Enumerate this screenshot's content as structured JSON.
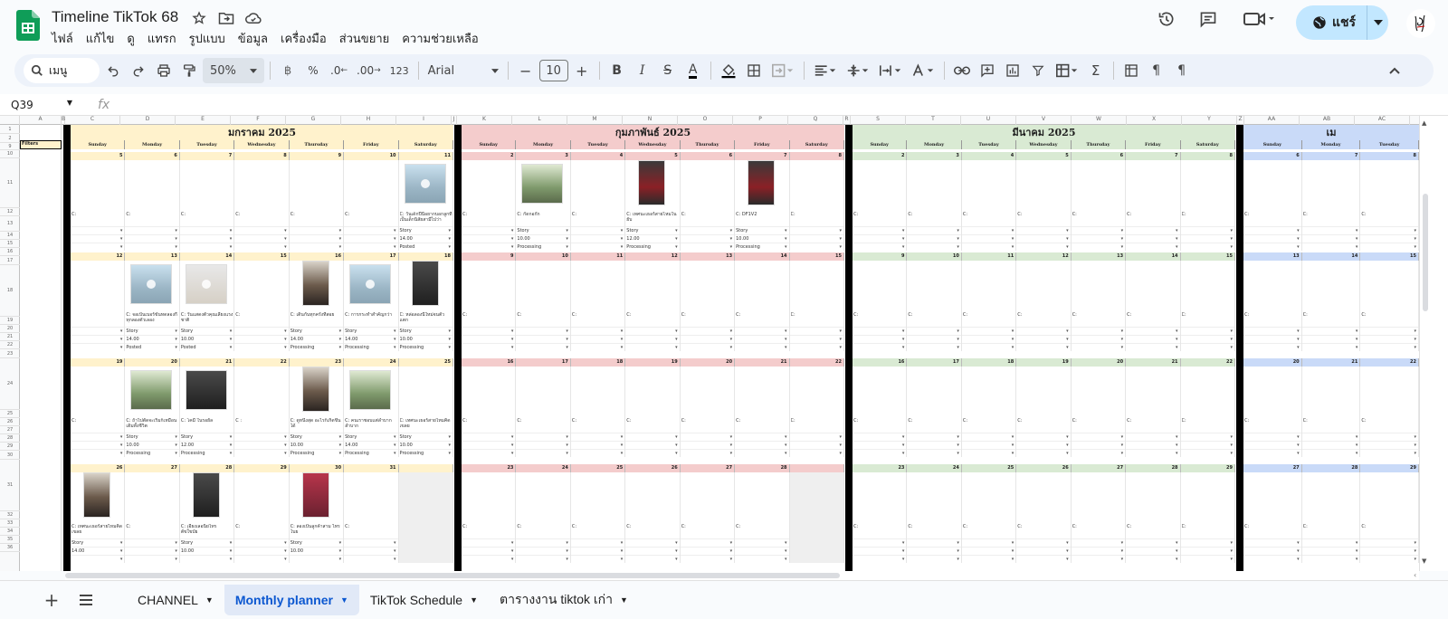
{
  "app": {
    "title": "Timeline TikTok 68",
    "menus": [
      "ไฟล์",
      "แก้ไข",
      "ดู",
      "แทรก",
      "รูปแบบ",
      "ข้อมูล",
      "เครื่องมือ",
      "ส่วนขยาย",
      "ความช่วยเหลือ"
    ],
    "share_label": "แชร์",
    "accent": "#c2e7ff"
  },
  "toolbar": {
    "search_label": "เมนู",
    "zoom": "50%",
    "percent": "%",
    "dec_less": ".0",
    "dec_more": ".00",
    "num_format": "123",
    "font": "Arial",
    "font_size": "10",
    "bold": "B",
    "italic": "I",
    "text_color": "A"
  },
  "formula_bar": {
    "cell_ref": "Q39",
    "fx": "fx"
  },
  "grid": {
    "columns": [
      "A",
      "B",
      "C",
      "D",
      "E",
      "F",
      "G",
      "H",
      "I",
      "J",
      "K",
      "L",
      "M",
      "N",
      "O",
      "P",
      "Q",
      "R",
      "S",
      "T",
      "U",
      "V",
      "W",
      "X",
      "Y",
      "Z",
      "AA",
      "AB",
      "AC"
    ],
    "rows": [
      "1",
      "2",
      "9",
      "10",
      "11",
      "12",
      "13",
      "14",
      "15",
      "16",
      "17",
      "18",
      "19",
      "20",
      "21",
      "22",
      "23",
      "24",
      "25",
      "26",
      "27",
      "28",
      "29",
      "30",
      "31",
      "32",
      "33",
      "34",
      "35",
      "36"
    ],
    "filters_label": "Filters",
    "day_names": [
      "Sunday",
      "Monday",
      "Tuesday",
      "Wednesday",
      "Thursday",
      "Friday",
      "Saturday"
    ],
    "months": [
      {
        "title": "มกราคม 2025",
        "color": "#fff2cc",
        "weeks": [
          {
            "days": [
              "5",
              "6",
              "7",
              "8",
              "9",
              "10",
              "11"
            ],
            "thumbs": [
              "",
              "",
              "",
              "",
              "",
              "",
              "s"
            ],
            "captions": [
              "C:",
              "C:",
              "C:",
              "C:",
              "C:",
              "C:",
              "C: วันเด็กปีนี้อยากบอกลูกที่เป็นเด็กนิสัยสามีไปว่า"
            ],
            "type": [
              "",
              "",
              "",
              "",
              "",
              "",
              "Story"
            ],
            "time": [
              "",
              "",
              "",
              "",
              "",
              "",
              "14.00"
            ],
            "status": [
              "",
              "",
              "",
              "",
              "",
              "",
              "Posted"
            ]
          },
          {
            "days": [
              "12",
              "13",
              "14",
              "15",
              "16",
              "17",
              "18"
            ],
            "thumbs": [
              "",
              "s",
              "d",
              "",
              "p",
              "s",
              "k"
            ],
            "captions": [
              "",
              "C: จอเป็นเบอร์ขันทดลองกี่ทุกลองตัวเลอง",
              "C: วันแสดงตัวคุณเลี้ยงแรงชาติ",
              "C:",
              "C: เดินกันทุกครั้งที่สอย",
              "C: การกระทำสำคัญกว่า",
              "C: หล่อลองนีใหม่จนตัวแตก"
            ],
            "type": [
              "",
              "Story",
              "Story",
              "",
              "Story",
              "Story",
              "Story"
            ],
            "time": [
              "",
              "14.00",
              "10.00",
              "",
              "14.00",
              "14.00",
              "10.00"
            ],
            "status": [
              "",
              "Posted",
              "Posted",
              "",
              "Processing",
              "Processing",
              "Processing"
            ]
          },
          {
            "days": [
              "19",
              "20",
              "21",
              "22",
              "23",
              "24",
              "25"
            ],
            "thumbs": [
              "",
              "g",
              "k",
              "",
              "p",
              "g",
              ""
            ],
            "captions": [
              "C:",
              "C: ถ้าไปตัดจะเริ่มก็เหมือนเดิมทั้งชีวิต",
              "C: โคมี่ ในรอยัล",
              "C :",
              "C: ดูหนึ่งสุด อะไรก็เกิดขึ้นได้",
              "C: คนเราชอบแต่ลำบากลำบาก",
              "C: เทศนะเธอร์สายไหมคิดเขลย"
            ],
            "type": [
              "",
              "Story",
              "Story",
              "",
              "Story",
              "Story",
              "Story"
            ],
            "time": [
              "",
              "10.00",
              "12.00",
              "",
              "10.00",
              "14.00",
              "10.00"
            ],
            "status": [
              "",
              "Processing",
              "Processing",
              "",
              "Processing",
              "Processing",
              "Processing"
            ]
          },
          {
            "days": [
              "26",
              "27",
              "28",
              "29",
              "30",
              "31",
              ""
            ],
            "thumbs": [
              "p",
              "",
              "k",
              "",
              "m",
              "",
              ""
            ],
            "captions": [
              "C: เทศนะเธอร์สายไหมคิดเขลย",
              "C:",
              "C: เอียงเลอนิยไทรต์ขใขบัย",
              "C:",
              "C: ลองเป็นลูกค้าสาม ไทรไบย",
              "C:",
              ""
            ],
            "type": [
              "Story",
              "",
              "Story",
              "",
              "Story",
              "",
              ""
            ],
            "time": [
              "14.00",
              "",
              "10.00",
              "",
              "10.00",
              "",
              ""
            ],
            "status": [
              "",
              "",
              "",
              "",
              "",
              "",
              ""
            ]
          }
        ]
      },
      {
        "title": "กุมภาพันธ์ 2025",
        "color": "#f4cccc",
        "weeks": [
          {
            "days": [
              "2",
              "3",
              "4",
              "5",
              "6",
              "7",
              "8"
            ],
            "thumbs": [
              "",
              "g",
              "",
              "r",
              "",
              "r",
              ""
            ],
            "captions": [
              "C:",
              "C: กัดกอกัก",
              "C:",
              "C: เทศนะเธอร์สายไหมในยับ",
              "C:",
              "C: DF1V2",
              "C:"
            ],
            "type": [
              "",
              "Story",
              "",
              "Story",
              "",
              "Story",
              ""
            ],
            "time": [
              "",
              "10.00",
              "",
              "12.00",
              "",
              "10.00",
              ""
            ],
            "status": [
              "",
              "Processing",
              "",
              "Processing",
              "",
              "Processing",
              ""
            ]
          },
          {
            "days": [
              "9",
              "10",
              "11",
              "12",
              "13",
              "14",
              "15"
            ],
            "thumbs": [
              "",
              "",
              "",
              "",
              "",
              "",
              ""
            ],
            "captions": [
              "C:",
              "C:",
              "C:",
              "C:",
              "C:",
              "C:",
              "C:"
            ],
            "type": [
              "",
              "",
              "",
              "",
              "",
              "",
              ""
            ],
            "time": [
              "",
              "",
              "",
              "",
              "",
              "",
              ""
            ],
            "status": [
              "",
              "",
              "",
              "",
              "",
              "",
              ""
            ]
          },
          {
            "days": [
              "16",
              "17",
              "18",
              "19",
              "20",
              "21",
              "22"
            ],
            "thumbs": [
              "",
              "",
              "",
              "",
              "",
              "",
              ""
            ],
            "captions": [
              "C:",
              "C:",
              "C:",
              "C:",
              "C:",
              "C:",
              "C:"
            ],
            "type": [
              "",
              "",
              "",
              "",
              "",
              "",
              ""
            ],
            "time": [
              "",
              "",
              "",
              "",
              "",
              "",
              ""
            ],
            "status": [
              "",
              "",
              "",
              "",
              "",
              "",
              ""
            ]
          },
          {
            "days": [
              "23",
              "24",
              "25",
              "26",
              "27",
              "28",
              ""
            ],
            "thumbs": [
              "",
              "",
              "",
              "",
              "",
              "",
              ""
            ],
            "captions": [
              "C:",
              "C:",
              "C:",
              "C:",
              "C:",
              "C:",
              ""
            ],
            "type": [
              "",
              "",
              "",
              "",
              "",
              "",
              ""
            ],
            "time": [
              "",
              "",
              "",
              "",
              "",
              "",
              ""
            ],
            "status": [
              "",
              "",
              "",
              "",
              "",
              "",
              ""
            ]
          }
        ]
      },
      {
        "title": "มีนาคม 2025",
        "color": "#d9ead3",
        "weeks": [
          {
            "days": [
              "2",
              "3",
              "4",
              "5",
              "6",
              "7",
              "8"
            ],
            "thumbs": [
              "",
              "",
              "",
              "",
              "",
              "",
              ""
            ],
            "captions": [
              "C:",
              "C:",
              "C:",
              "C:",
              "C:",
              "C:",
              "C:"
            ],
            "type": [
              "",
              "",
              "",
              "",
              "",
              "",
              ""
            ],
            "time": [
              "",
              "",
              "",
              "",
              "",
              "",
              ""
            ],
            "status": [
              "",
              "",
              "",
              "",
              "",
              "",
              ""
            ]
          },
          {
            "days": [
              "9",
              "10",
              "11",
              "12",
              "13",
              "14",
              "15"
            ],
            "thumbs": [
              "",
              "",
              "",
              "",
              "",
              "",
              ""
            ],
            "captions": [
              "C:",
              "C:",
              "C:",
              "C:",
              "C:",
              "C:",
              "C:"
            ],
            "type": [
              "",
              "",
              "",
              "",
              "",
              "",
              ""
            ],
            "time": [
              "",
              "",
              "",
              "",
              "",
              "",
              ""
            ],
            "status": [
              "",
              "",
              "",
              "",
              "",
              "",
              ""
            ]
          },
          {
            "days": [
              "16",
              "17",
              "18",
              "19",
              "20",
              "21",
              "22"
            ],
            "thumbs": [
              "",
              "",
              "",
              "",
              "",
              "",
              ""
            ],
            "captions": [
              "C:",
              "C:",
              "C:",
              "C:",
              "C:",
              "C:",
              "C:"
            ],
            "type": [
              "",
              "",
              "",
              "",
              "",
              "",
              ""
            ],
            "time": [
              "",
              "",
              "",
              "",
              "",
              "",
              ""
            ],
            "status": [
              "",
              "",
              "",
              "",
              "",
              "",
              ""
            ]
          },
          {
            "days": [
              "23",
              "24",
              "25",
              "26",
              "27",
              "28",
              "29"
            ],
            "thumbs": [
              "",
              "",
              "",
              "",
              "",
              "",
              ""
            ],
            "captions": [
              "C:",
              "C:",
              "C:",
              "C:",
              "C:",
              "C:",
              "C:"
            ],
            "type": [
              "",
              "",
              "",
              "",
              "",
              "",
              ""
            ],
            "time": [
              "",
              "",
              "",
              "",
              "",
              "",
              ""
            ],
            "status": [
              "",
              "",
              "",
              "",
              "",
              "",
              ""
            ]
          }
        ]
      },
      {
        "title": "เม",
        "color": "#c9daf8",
        "weeks": [
          {
            "days": [
              "6",
              "7",
              "8"
            ],
            "thumbs": [
              "",
              "",
              ""
            ],
            "captions": [
              "C:",
              "C:",
              "C:"
            ],
            "type": [
              "",
              "",
              ""
            ],
            "time": [
              "",
              "",
              ""
            ],
            "status": [
              "",
              "",
              ""
            ]
          },
          {
            "days": [
              "13",
              "14",
              "15"
            ],
            "thumbs": [
              "",
              "",
              ""
            ],
            "captions": [
              "C:",
              "C:",
              "C:"
            ],
            "type": [
              "",
              "",
              ""
            ],
            "time": [
              "",
              "",
              ""
            ],
            "status": [
              "",
              "",
              ""
            ]
          },
          {
            "days": [
              "20",
              "21",
              "22"
            ],
            "thumbs": [
              "",
              "",
              ""
            ],
            "captions": [
              "C:",
              "C:",
              "C:"
            ],
            "type": [
              "",
              "",
              ""
            ],
            "time": [
              "",
              "",
              ""
            ],
            "status": [
              "",
              "",
              ""
            ]
          },
          {
            "days": [
              "27",
              "28",
              "29"
            ],
            "thumbs": [
              "",
              "",
              ""
            ],
            "captions": [
              "C:",
              "C:",
              "C:"
            ],
            "type": [
              "",
              "",
              ""
            ],
            "time": [
              "",
              "",
              ""
            ],
            "status": [
              "",
              "",
              ""
            ]
          }
        ]
      }
    ]
  },
  "sheet_tabs": [
    {
      "label": "CHANNEL",
      "active": false
    },
    {
      "label": "Monthly planner",
      "active": true
    },
    {
      "label": "TikTok Schedule",
      "active": false
    },
    {
      "label": "ตารางงาน tiktok เก่า",
      "active": false
    }
  ]
}
